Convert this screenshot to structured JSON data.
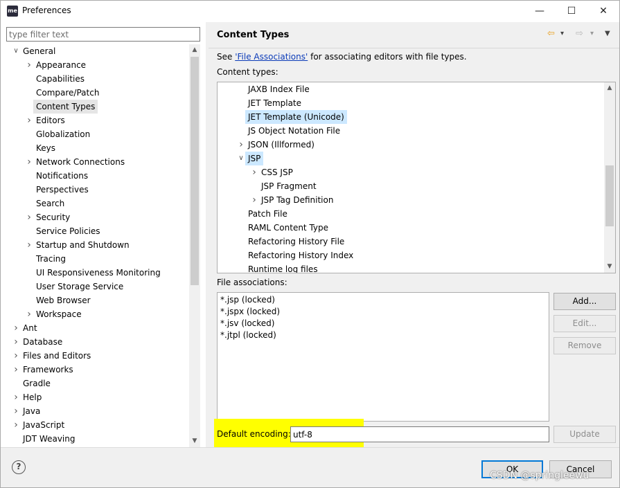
{
  "window": {
    "app_icon_text": "me",
    "title": "Preferences",
    "minimize": "—",
    "maximize": "☐",
    "close": "✕"
  },
  "filter": {
    "placeholder": "type filter text"
  },
  "tree": [
    {
      "label": "General",
      "depth": 0,
      "state": "expanded"
    },
    {
      "label": "Appearance",
      "depth": 1,
      "state": "collapsed"
    },
    {
      "label": "Capabilities",
      "depth": 1,
      "state": "leaf"
    },
    {
      "label": "Compare/Patch",
      "depth": 1,
      "state": "leaf"
    },
    {
      "label": "Content Types",
      "depth": 1,
      "state": "leaf",
      "selected": true
    },
    {
      "label": "Editors",
      "depth": 1,
      "state": "collapsed"
    },
    {
      "label": "Globalization",
      "depth": 1,
      "state": "leaf"
    },
    {
      "label": "Keys",
      "depth": 1,
      "state": "leaf"
    },
    {
      "label": "Network Connections",
      "depth": 1,
      "state": "collapsed"
    },
    {
      "label": "Notifications",
      "depth": 1,
      "state": "leaf"
    },
    {
      "label": "Perspectives",
      "depth": 1,
      "state": "leaf"
    },
    {
      "label": "Search",
      "depth": 1,
      "state": "leaf"
    },
    {
      "label": "Security",
      "depth": 1,
      "state": "collapsed"
    },
    {
      "label": "Service Policies",
      "depth": 1,
      "state": "leaf"
    },
    {
      "label": "Startup and Shutdown",
      "depth": 1,
      "state": "collapsed"
    },
    {
      "label": "Tracing",
      "depth": 1,
      "state": "leaf"
    },
    {
      "label": "UI Responsiveness Monitoring",
      "depth": 1,
      "state": "leaf"
    },
    {
      "label": "User Storage Service",
      "depth": 1,
      "state": "leaf"
    },
    {
      "label": "Web Browser",
      "depth": 1,
      "state": "leaf"
    },
    {
      "label": "Workspace",
      "depth": 1,
      "state": "collapsed"
    },
    {
      "label": "Ant",
      "depth": 0,
      "state": "collapsed"
    },
    {
      "label": "Database",
      "depth": 0,
      "state": "collapsed"
    },
    {
      "label": "Files and Editors",
      "depth": 0,
      "state": "collapsed"
    },
    {
      "label": "Frameworks",
      "depth": 0,
      "state": "collapsed"
    },
    {
      "label": "Gradle",
      "depth": 0,
      "state": "leaf"
    },
    {
      "label": "Help",
      "depth": 0,
      "state": "collapsed"
    },
    {
      "label": "Java",
      "depth": 0,
      "state": "collapsed"
    },
    {
      "label": "JavaScript",
      "depth": 0,
      "state": "collapsed"
    },
    {
      "label": "JDT Weaving",
      "depth": 0,
      "state": "leaf"
    }
  ],
  "page": {
    "title": "Content Types",
    "description_prefix": "See ",
    "description_link": "'File Associations'",
    "description_suffix": " for associating editors with file types.",
    "content_types_label": "Content types:",
    "file_associations_label": "File associations:",
    "default_encoding_label": "Default encoding:",
    "default_encoding_value": "utf-8"
  },
  "content_types": [
    {
      "label": "JAXB Index File",
      "depth": 0,
      "state": "leaf"
    },
    {
      "label": "JET Template",
      "depth": 0,
      "state": "leaf"
    },
    {
      "label": "JET Template (Unicode)",
      "depth": 0,
      "state": "leaf",
      "hover": true
    },
    {
      "label": "JS Object Notation File",
      "depth": 0,
      "state": "leaf"
    },
    {
      "label": "JSON (Illformed)",
      "depth": 0,
      "state": "collapsed"
    },
    {
      "label": "JSP",
      "depth": 0,
      "state": "expanded",
      "selected": true
    },
    {
      "label": "CSS JSP",
      "depth": 1,
      "state": "collapsed"
    },
    {
      "label": "JSP Fragment",
      "depth": 1,
      "state": "leaf"
    },
    {
      "label": "JSP Tag Definition",
      "depth": 1,
      "state": "collapsed"
    },
    {
      "label": "Patch File",
      "depth": 0,
      "state": "leaf"
    },
    {
      "label": "RAML Content Type",
      "depth": 0,
      "state": "leaf"
    },
    {
      "label": "Refactoring History File",
      "depth": 0,
      "state": "leaf"
    },
    {
      "label": "Refactoring History Index",
      "depth": 0,
      "state": "leaf"
    },
    {
      "label": "Runtime log files",
      "depth": 0,
      "state": "leaf"
    }
  ],
  "file_associations": [
    "*.jsp (locked)",
    "*.jspx (locked)",
    "*.jsv (locked)",
    "*.jtpl (locked)"
  ],
  "buttons": {
    "add": "Add...",
    "edit": "Edit...",
    "remove": "Remove",
    "update": "Update",
    "ok": "OK",
    "cancel": "Cancel",
    "help": "?"
  },
  "nav": {
    "back": "⇦",
    "forward": "⇨",
    "dropdown": "▾",
    "menu": "▼"
  },
  "watermark": "CSDN @springleewu",
  "colors": {
    "selection_blue": "#cce8ff",
    "highlight_yellow": "#ffff00",
    "link": "#0a3ab8",
    "nav_arrow": "#e8a020"
  }
}
